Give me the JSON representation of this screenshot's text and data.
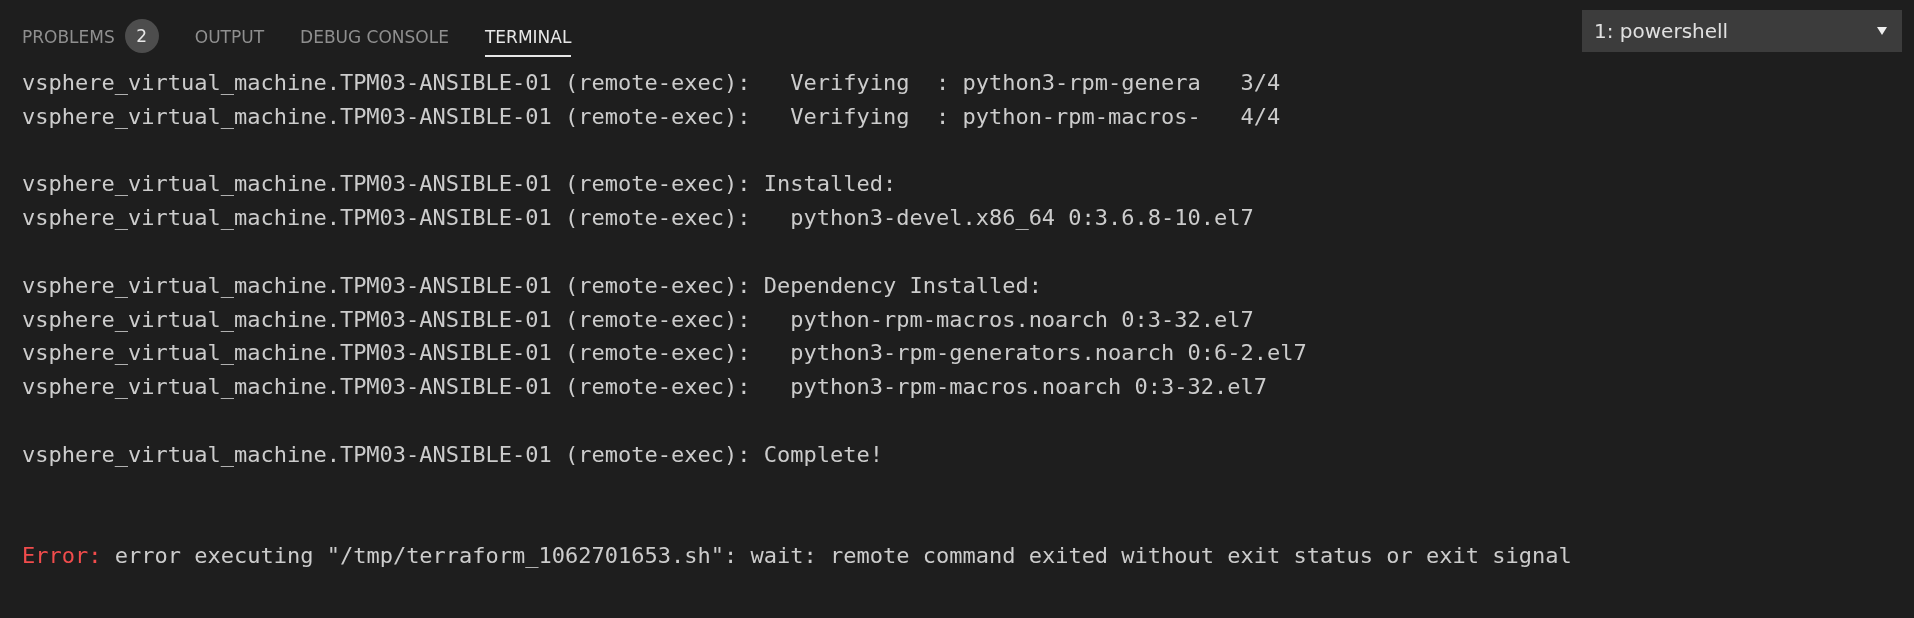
{
  "tabs": [
    {
      "label": "PROBLEMS",
      "badge": "2",
      "selected": false
    },
    {
      "label": "OUTPUT",
      "selected": false
    },
    {
      "label": "DEBUG CONSOLE",
      "selected": false
    },
    {
      "label": "TERMINAL",
      "selected": true
    }
  ],
  "terminal_selector": {
    "value": "1: powershell"
  },
  "terminal_lines": [
    {
      "kind": "text",
      "text": "vsphere_virtual_machine.TPM03-ANSIBLE-01 (remote-exec):   Verifying  : python3-rpm-genera   3/4"
    },
    {
      "kind": "text",
      "text": "vsphere_virtual_machine.TPM03-ANSIBLE-01 (remote-exec):   Verifying  : python-rpm-macros-   4/4"
    },
    {
      "kind": "blank"
    },
    {
      "kind": "text",
      "text": "vsphere_virtual_machine.TPM03-ANSIBLE-01 (remote-exec): Installed:"
    },
    {
      "kind": "text",
      "text": "vsphere_virtual_machine.TPM03-ANSIBLE-01 (remote-exec):   python3-devel.x86_64 0:3.6.8-10.el7"
    },
    {
      "kind": "blank"
    },
    {
      "kind": "text",
      "text": "vsphere_virtual_machine.TPM03-ANSIBLE-01 (remote-exec): Dependency Installed:"
    },
    {
      "kind": "text",
      "text": "vsphere_virtual_machine.TPM03-ANSIBLE-01 (remote-exec):   python-rpm-macros.noarch 0:3-32.el7"
    },
    {
      "kind": "text",
      "text": "vsphere_virtual_machine.TPM03-ANSIBLE-01 (remote-exec):   python3-rpm-generators.noarch 0:6-2.el7"
    },
    {
      "kind": "text",
      "text": "vsphere_virtual_machine.TPM03-ANSIBLE-01 (remote-exec):   python3-rpm-macros.noarch 0:3-32.el7"
    },
    {
      "kind": "blank"
    },
    {
      "kind": "text",
      "text": "vsphere_virtual_machine.TPM03-ANSIBLE-01 (remote-exec): Complete!"
    },
    {
      "kind": "blank"
    },
    {
      "kind": "blank"
    },
    {
      "kind": "error",
      "label": "Error:",
      "text": "error executing \"/tmp/terraform_1062701653.sh\": wait: remote command exited without exit status or exit signal"
    }
  ]
}
